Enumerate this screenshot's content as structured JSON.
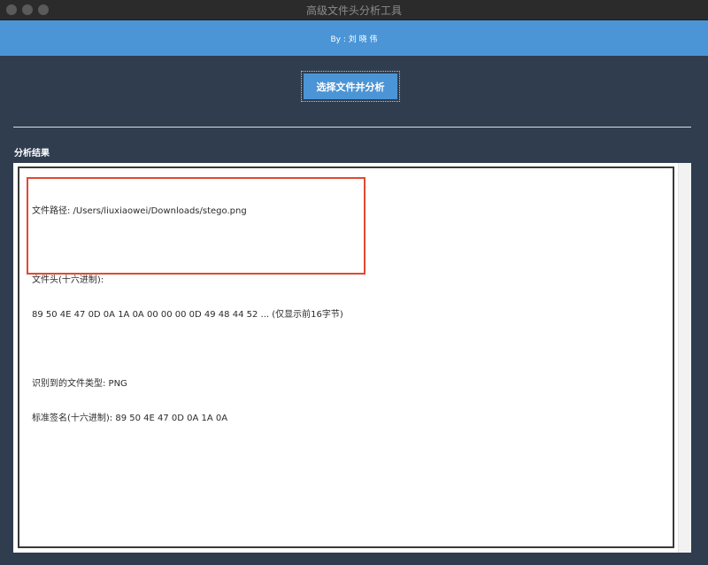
{
  "window": {
    "title": "高级文件头分析工具"
  },
  "header": {
    "author": "By : 刘 晓 伟"
  },
  "toolbar": {
    "analyze_button_label": "选择文件并分析"
  },
  "results": {
    "section_label": "分析结果",
    "file_path_line": "文件路径: /Users/liuxiaowei/Downloads/stego.png",
    "header_label_line": "文件头(十六进制):",
    "header_hex_line": "89 50 4E 47 0D 0A 1A 0A 00 00 00 0D 49 48 44 52 ... (仅显示前16字节)",
    "detected_type_line": "识别到的文件类型: PNG",
    "standard_signature_line": "标准签名(十六进制): 89 50 4E 47 0D 0A 1A 0A"
  },
  "colors": {
    "background": "#2f3d4f",
    "accent": "#4b95d6",
    "highlight": "#e0492f"
  }
}
